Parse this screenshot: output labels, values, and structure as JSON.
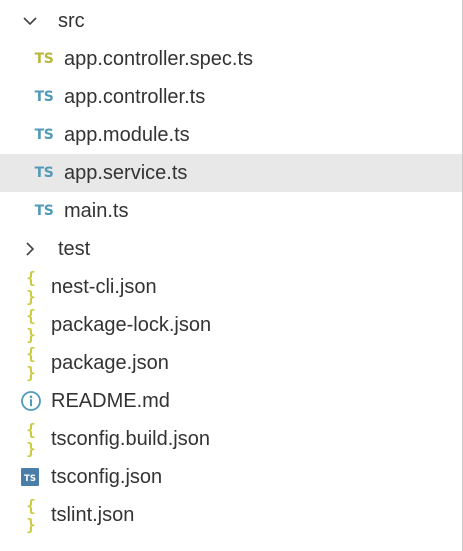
{
  "explorer": {
    "src_folder": {
      "label": "src",
      "expanded": true,
      "files": [
        {
          "label": "app.controller.spec.ts",
          "icon": "TS",
          "icon_color": "#b7b73b"
        },
        {
          "label": "app.controller.ts",
          "icon": "TS",
          "icon_color": "#519aba"
        },
        {
          "label": "app.module.ts",
          "icon": "TS",
          "icon_color": "#519aba"
        },
        {
          "label": "app.service.ts",
          "icon": "TS",
          "icon_color": "#519aba",
          "selected": true
        },
        {
          "label": "main.ts",
          "icon": "TS",
          "icon_color": "#519aba"
        }
      ]
    },
    "test_folder": {
      "label": "test",
      "expanded": false
    },
    "root_files": [
      {
        "label": "nest-cli.json",
        "icon": "{ }",
        "icon_color": "#cbcb41"
      },
      {
        "label": "package-lock.json",
        "icon": "{ }",
        "icon_color": "#cbcb41"
      },
      {
        "label": "package.json",
        "icon": "{ }",
        "icon_color": "#cbcb41"
      },
      {
        "label": "README.md",
        "icon": "info-icon",
        "icon_color": "#519aba"
      },
      {
        "label": "tsconfig.build.json",
        "icon": "{ }",
        "icon_color": "#cbcb41"
      },
      {
        "label": "tsconfig.json",
        "icon": "TS",
        "icon_color": "#4a7ea8"
      },
      {
        "label": "tslint.json",
        "icon": "{ }",
        "icon_color": "#cbcb41"
      }
    ]
  }
}
